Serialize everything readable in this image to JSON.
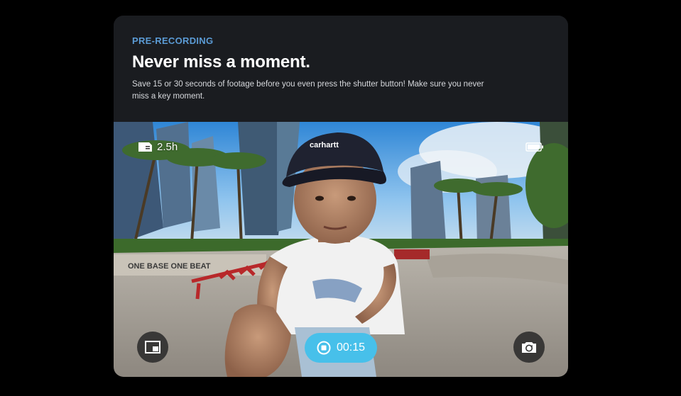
{
  "header": {
    "eyebrow": "PRE-RECORDING",
    "title": "Never miss a moment.",
    "description": "Save 15 or 30 seconds of footage before you even press the shutter button! Make sure you never miss a key moment."
  },
  "viewfinder": {
    "storage_remaining": "2.5h",
    "recording_time": "00:15",
    "scene_signage": "ONE BASE   ONE BEAT",
    "cap_logo": "carhartt",
    "icons": {
      "storage": "sd-card-icon",
      "battery": "battery-icon",
      "pip": "picture-in-picture-icon",
      "record": "record-stop-icon",
      "camera": "camera-switch-icon"
    }
  },
  "colors": {
    "accent": "#5b9bd5",
    "record_pill": "#47c0ea",
    "card_bg": "#1a1c20"
  }
}
